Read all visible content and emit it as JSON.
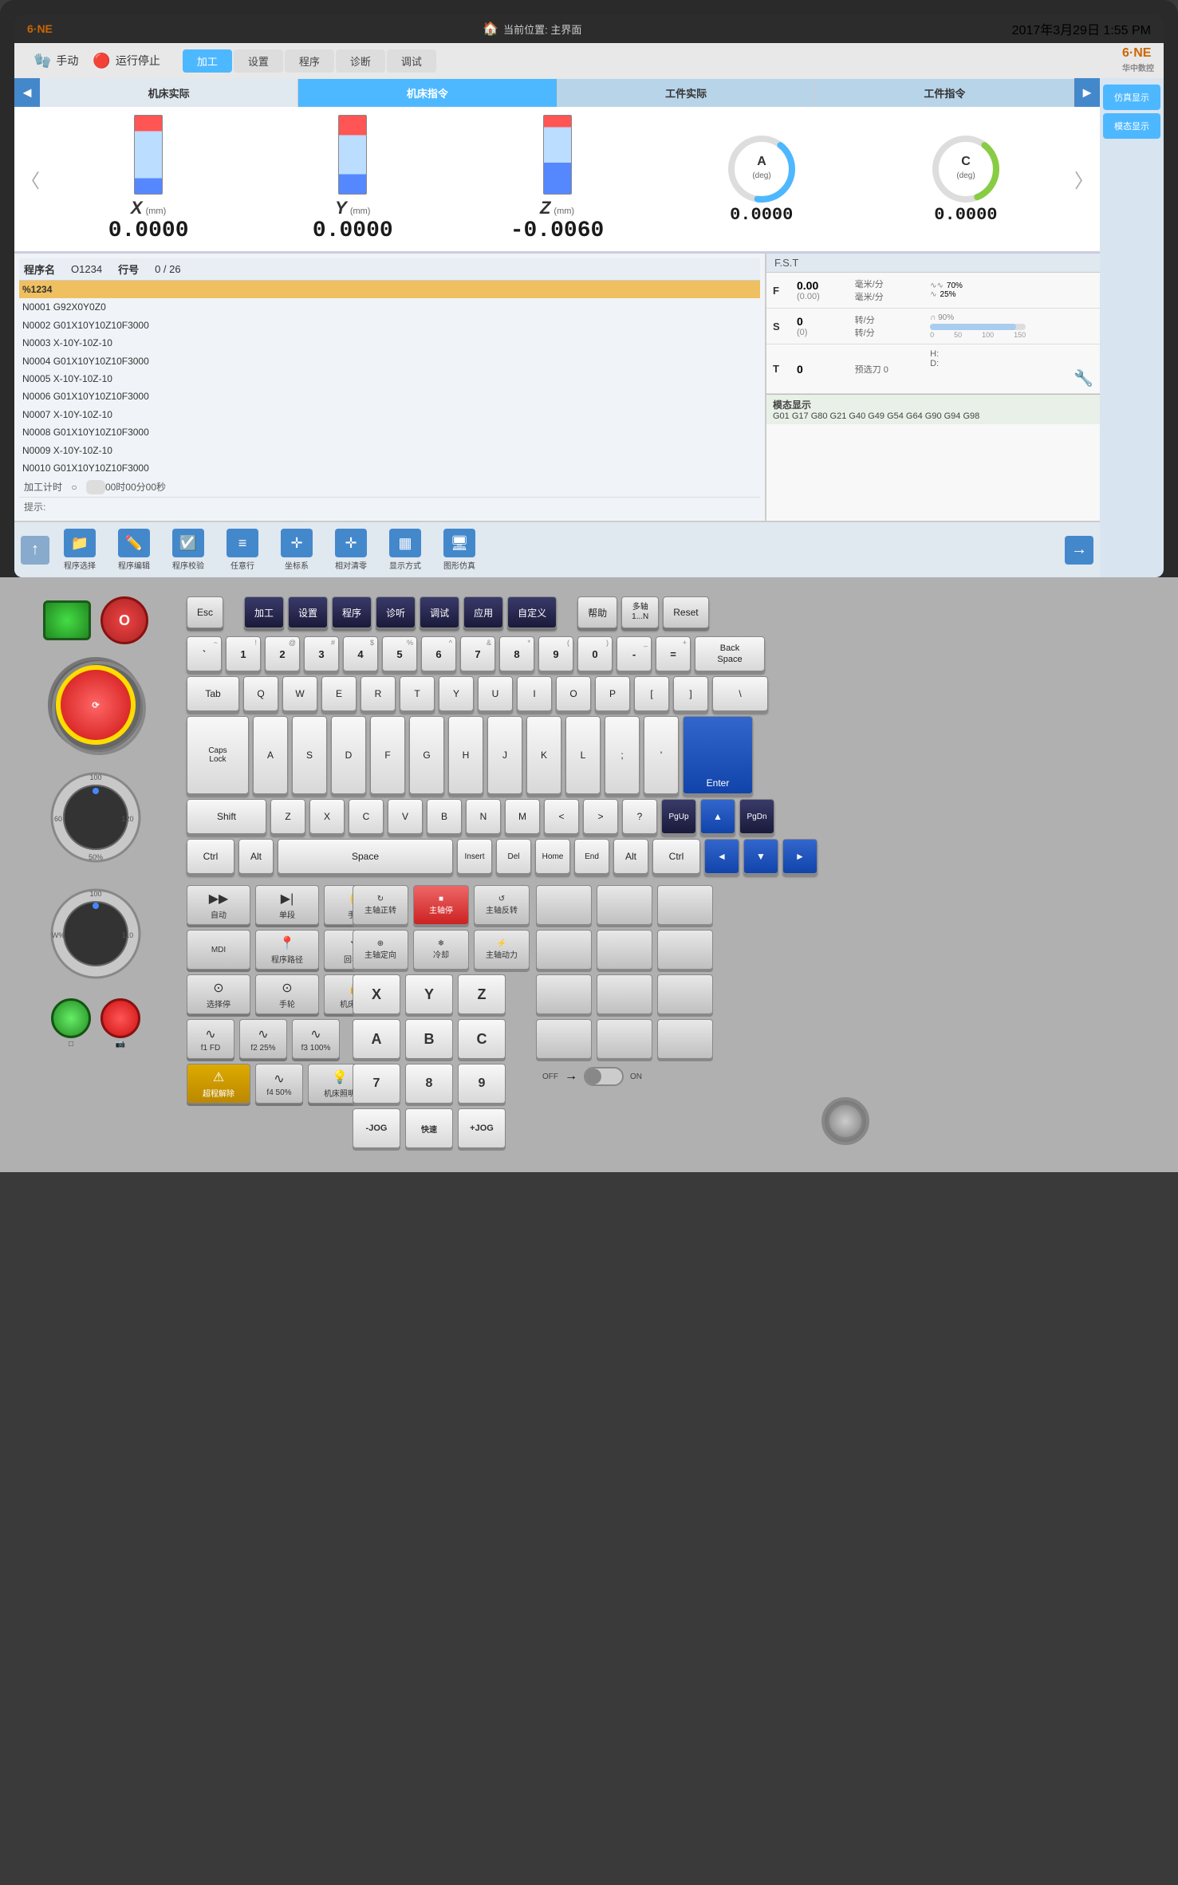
{
  "screen": {
    "topbar": {
      "location_label": "当前位置: 主界面",
      "datetime": "2017年3月29日 1:55 PM"
    },
    "navbar": {
      "mode": "手动",
      "status": "运行停止",
      "tabs": [
        "加工",
        "设置",
        "程序",
        "诊断",
        "调试"
      ],
      "active_tab": "加工",
      "logo": "6·NE 华中数控"
    },
    "axes": {
      "tabs": [
        "机床实际",
        "机床指令",
        "工件实际",
        "工件指令"
      ],
      "active_tab": "机床指令",
      "items": [
        {
          "label": "X",
          "unit": "(mm)",
          "value": "0.0000",
          "bar_pct": 50
        },
        {
          "label": "Y",
          "unit": "(mm)",
          "value": "0.0000",
          "bar_pct": 50
        },
        {
          "label": "Z",
          "unit": "(mm)",
          "value": "-0.0060",
          "bar_pct": 40
        },
        {
          "label": "A",
          "unit": "(deg)",
          "value": "0.0000",
          "type": "gauge"
        },
        {
          "label": "C",
          "unit": "(deg)",
          "value": "0.0000",
          "type": "gauge"
        }
      ]
    },
    "program": {
      "name_label": "程序名",
      "name_value": "O1234",
      "line_label": "行号",
      "line_value": "0 / 26",
      "lines": [
        {
          "text": "%1234",
          "highlight": true
        },
        {
          "text": "N0001 G92X0Y0Z0"
        },
        {
          "text": "N0002 G01X10Y10Z10F3000"
        },
        {
          "text": "N0003 X-10Y-10Z-10"
        },
        {
          "text": "N0004 G01X10Y10Z10F3000"
        },
        {
          "text": "N0005 X-10Y-10Z-10"
        },
        {
          "text": "N0006 G01X10Y10Z10F3000"
        },
        {
          "text": "N0007 X-10Y-10Z-10"
        },
        {
          "text": "N0008 G01X10Y10Z10F3000"
        },
        {
          "text": "N0009 X-10Y-10Z-10"
        },
        {
          "text": "N0010 G01X10Y10Z10F3000"
        }
      ],
      "timer_label": "加工计时",
      "timer_value": "00时00分00秒",
      "hint_label": "提示:"
    },
    "fst": {
      "header": "F.S.T",
      "rows": [
        {
          "label": "F",
          "value": "0.00",
          "sub_value": "(0.00)",
          "unit1": "毫米/分",
          "unit2": "毫米/分",
          "bar_pct": 70,
          "bar_label": "70%",
          "bar2_pct": 25,
          "bar2_label": "25%"
        },
        {
          "label": "S",
          "value": "0",
          "sub_value": "(0)",
          "unit1": "转/分",
          "unit2": "转/分",
          "bar_pct": 90,
          "bar_label": "90%"
        },
        {
          "label": "T",
          "value": "0",
          "pre_label": "预选刀",
          "pre_value": "0",
          "h_label": "H:",
          "d_label": "D:"
        }
      ]
    },
    "modal_display": {
      "label": "模态显示",
      "codes": "G01  G17  G80  G21  G40  G49  G54  G64  G90  G94  G98"
    },
    "side_buttons": [
      {
        "label": "仿真显示"
      },
      {
        "label": "模态显示"
      }
    ],
    "toolbar": {
      "items": [
        {
          "icon": "↑",
          "label": ""
        },
        {
          "icon": "📁",
          "label": "程序选择"
        },
        {
          "icon": "✏️",
          "label": "程序编辑"
        },
        {
          "icon": "✔️",
          "label": "程序校验"
        },
        {
          "icon": "▶",
          "label": "任意行"
        },
        {
          "icon": "⊕",
          "label": "坐标系"
        },
        {
          "icon": "⊕",
          "label": "相对清零"
        },
        {
          "icon": "▦",
          "label": "显示方式"
        },
        {
          "icon": "🖥",
          "label": "图形仿真"
        },
        {
          "icon": "→",
          "label": ""
        }
      ]
    }
  },
  "keyboard": {
    "fn_row": {
      "keys": [
        {
          "label": "Esc",
          "style": "normal"
        },
        {
          "label": "加工",
          "style": "dark"
        },
        {
          "label": "设置",
          "style": "dark"
        },
        {
          "label": "程序",
          "style": "dark"
        },
        {
          "label": "诊听",
          "style": "dark"
        },
        {
          "label": "调试",
          "style": "dark"
        },
        {
          "label": "应用",
          "style": "dark"
        },
        {
          "label": "自定义",
          "style": "dark"
        },
        {
          "label": "帮助",
          "style": "normal"
        },
        {
          "label": "多轴\n1...N",
          "style": "normal"
        },
        {
          "label": "Reset",
          "style": "normal"
        }
      ]
    },
    "row1": {
      "keys": [
        {
          "top": "~",
          "main": "`",
          "sub": ""
        },
        {
          "top": "!",
          "main": "1"
        },
        {
          "top": "@",
          "main": "2"
        },
        {
          "top": "#",
          "main": "3"
        },
        {
          "top": "$",
          "main": "4"
        },
        {
          "top": "%",
          "main": "5"
        },
        {
          "top": "^",
          "main": "6"
        },
        {
          "top": "&",
          "main": "7"
        },
        {
          "top": "*",
          "main": "8"
        },
        {
          "top": "(",
          "main": "9"
        },
        {
          "top": ")",
          "main": "0"
        },
        {
          "top": "_",
          "main": "-"
        },
        {
          "top": "+",
          "main": "="
        },
        {
          "main": "Back\nSpace",
          "style": "wide"
        }
      ]
    },
    "row2": {
      "keys": [
        {
          "main": "Tab",
          "style": "wide"
        },
        {
          "main": "Q"
        },
        {
          "main": "W"
        },
        {
          "main": "E"
        },
        {
          "main": "R"
        },
        {
          "main": "T"
        },
        {
          "main": "Y"
        },
        {
          "main": "U"
        },
        {
          "main": "I"
        },
        {
          "main": "O"
        },
        {
          "main": "P"
        },
        {
          "main": "["
        },
        {
          "main": "]"
        },
        {
          "main": "\\",
          "style": "wide"
        }
      ]
    },
    "row3": {
      "keys": [
        {
          "main": "Caps\nLock",
          "style": "wide"
        },
        {
          "main": "A"
        },
        {
          "main": "S"
        },
        {
          "main": "D"
        },
        {
          "main": "F"
        },
        {
          "main": "G"
        },
        {
          "main": "H"
        },
        {
          "main": "J"
        },
        {
          "main": "K"
        },
        {
          "main": "L"
        },
        {
          "main": ";"
        },
        {
          "main": "'"
        },
        {
          "main": "Enter",
          "style": "wider blue tall"
        }
      ]
    },
    "row4": {
      "keys": [
        {
          "main": "Shift",
          "style": "wider"
        },
        {
          "main": "Z"
        },
        {
          "main": "X"
        },
        {
          "main": "C"
        },
        {
          "main": "V"
        },
        {
          "main": "B"
        },
        {
          "main": "N"
        },
        {
          "main": "M"
        },
        {
          "main": "<"
        },
        {
          "main": ">"
        },
        {
          "main": "?"
        },
        {
          "main": "PgUp",
          "style": "dark"
        },
        {
          "main": "▲",
          "style": "blue"
        },
        {
          "main": "PgDn",
          "style": "dark"
        }
      ]
    },
    "row5": {
      "keys": [
        {
          "main": "Ctrl",
          "style": "wide"
        },
        {
          "main": "Alt"
        },
        {
          "main": "Space",
          "style": "widest"
        },
        {
          "main": "Insert"
        },
        {
          "main": "Del"
        },
        {
          "main": "Home"
        },
        {
          "main": "End"
        },
        {
          "main": "Alt"
        },
        {
          "main": "Ctrl",
          "style": "wide"
        },
        {
          "main": "◄",
          "style": "blue"
        },
        {
          "main": "▼",
          "style": "blue"
        },
        {
          "main": "►",
          "style": "blue"
        }
      ]
    },
    "cnc_panel": {
      "mode_keys": [
        {
          "label": "自动",
          "icon": "▶▶"
        },
        {
          "label": "单段",
          "icon": "▶|"
        },
        {
          "label": "手动",
          "icon": "✋"
        },
        {
          "label": "MDI",
          "icon": "M"
        },
        {
          "label": "程序路径",
          "icon": "📍"
        },
        {
          "label": "回参点",
          "icon": "⟲"
        },
        {
          "label": "选择停",
          "icon": "⊙"
        },
        {
          "label": "手轮",
          "icon": "⊙"
        }
      ],
      "machine_keys": [
        {
          "label": "机床锁住",
          "icon": "🔒"
        }
      ],
      "spindle_keys": [
        {
          "label": "主轴正转",
          "icon": "↻"
        },
        {
          "label": "主轴停",
          "icon": "■",
          "style": "red"
        },
        {
          "label": "主轴反转",
          "icon": "↺"
        },
        {
          "label": "主轴定向",
          "icon": "⊕"
        },
        {
          "label": "冷却",
          "icon": "❄"
        },
        {
          "label": "主轴动力",
          "icon": "⚡"
        }
      ],
      "axis_keys": [
        "X",
        "Y",
        "Z",
        "A",
        "B",
        "C"
      ],
      "num_keys": [
        "7",
        "8",
        "9",
        "-JOG",
        "快速",
        "+JOG"
      ],
      "special_keys": [
        {
          "label": "超程解除",
          "icon": "⚠"
        },
        {
          "label": "机床照明",
          "icon": "💡"
        }
      ],
      "fn_keys": [
        {
          "label": "f1\nFD",
          "icon": "∿"
        },
        {
          "label": "f2\n25%",
          "icon": "∿"
        },
        {
          "label": "f3\n100%",
          "icon": "∿"
        },
        {
          "label": "f4\n50%",
          "icon": "∿"
        }
      ]
    }
  }
}
